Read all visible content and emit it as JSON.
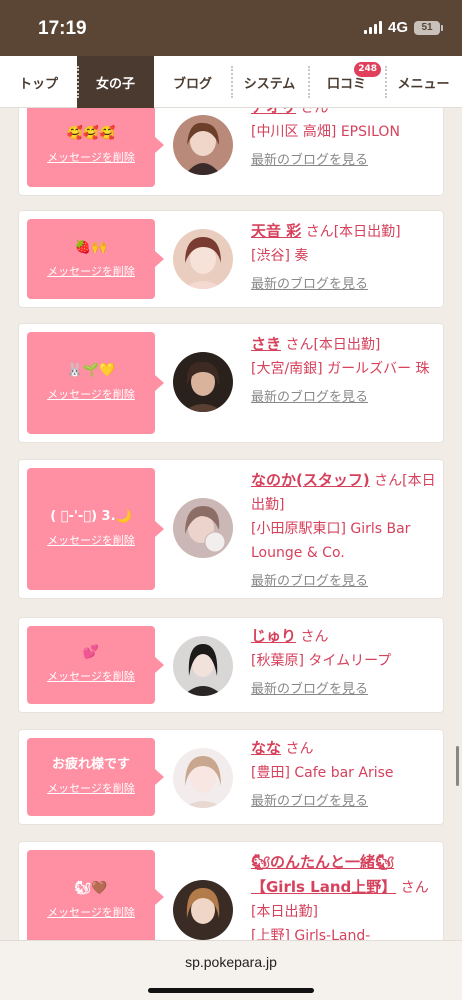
{
  "status": {
    "time": "17:19",
    "network": "4G",
    "battery": "51"
  },
  "nav": {
    "items": [
      {
        "label": "トップ"
      },
      {
        "label": "女の子"
      },
      {
        "label": "ブログ"
      },
      {
        "label": "システム"
      },
      {
        "label": "口コミ",
        "badge": "248"
      },
      {
        "label": "メニュー"
      }
    ],
    "active_index": 1
  },
  "delete_label": "メッセージを削除",
  "blog_label": "最新のブログを見る",
  "san": "さん",
  "cards": [
    {
      "message": "🥰🥰🥰",
      "name": "アオリ",
      "tag": "",
      "location": "[中川区 高畑] EPSILON"
    },
    {
      "message": "🍓🙌",
      "name": "天音 彩",
      "tag": "[本日出勤]",
      "location": "[渋谷] 奏"
    },
    {
      "message": "🐰🌱💛",
      "name": "さき",
      "tag": "[本日出勤]",
      "location": "[大宮/南銀] ガールズバー 珠"
    },
    {
      "message": "( ﾟ-'-ﾟ) 3.🌙",
      "name": "なのか(スタッフ)",
      "tag": "[本日出勤]",
      "location": "[小田原駅東口] Girls Bar Lounge & Co."
    },
    {
      "message": "💕",
      "name": "じゅり",
      "tag": "",
      "location": "[秋葉原] タイムリープ"
    },
    {
      "message": "お疲れ様です",
      "name": "なな",
      "tag": "",
      "location": "[豊田] Cafe bar Arise"
    },
    {
      "message": "🐿🤎",
      "name": "🐿のんたんと一緒🐿【Girls Land上野】",
      "tag": "[本日出勤]",
      "location": "[上野] Girls-Land-"
    }
  ],
  "url": "sp.pokepara.jp"
}
